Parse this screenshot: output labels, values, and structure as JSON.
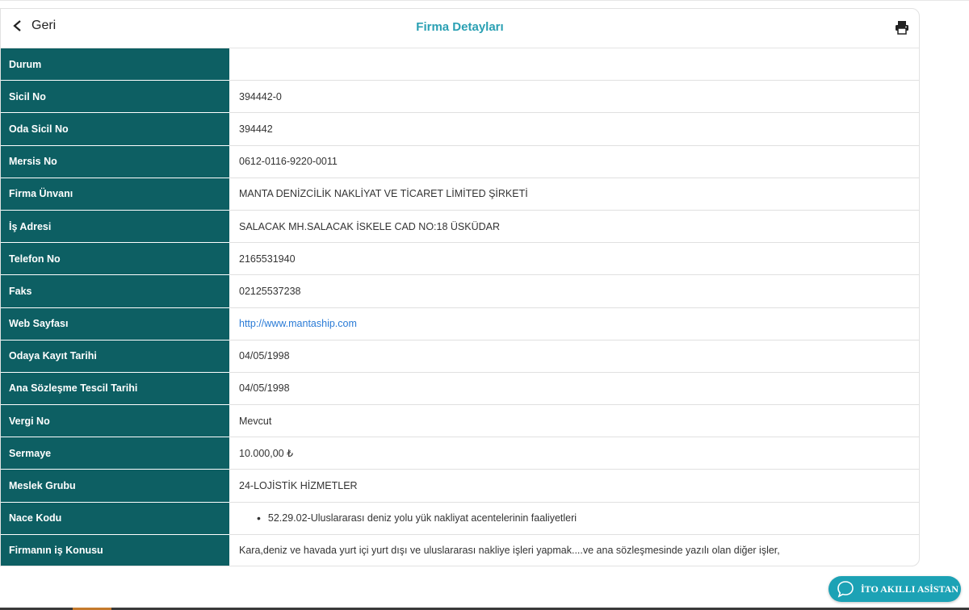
{
  "header": {
    "back_label": "Geri",
    "title": "Firma Detayları"
  },
  "rows": [
    {
      "label": "Durum",
      "value": ""
    },
    {
      "label": "Sicil No",
      "value": "394442-0"
    },
    {
      "label": "Oda Sicil No",
      "value": "394442"
    },
    {
      "label": "Mersis No",
      "value": "0612-0116-9220-0011"
    },
    {
      "label": "Firma Ünvanı",
      "value": "MANTA DENİZCİLİK NAKLİYAT VE TİCARET LİMİTED ŞİRKETİ"
    },
    {
      "label": "İş Adresi",
      "value": "SALACAK MH.SALACAK İSKELE CAD NO:18 ÜSKÜDAR"
    },
    {
      "label": "Telefon No",
      "value": "2165531940"
    },
    {
      "label": "Faks",
      "value": "02125537238"
    },
    {
      "label": "Web Sayfası",
      "value": "http://www.mantaship.com"
    },
    {
      "label": "Odaya Kayıt Tarihi",
      "value": "04/05/1998"
    },
    {
      "label": "Ana Sözleşme Tescil Tarihi",
      "value": "04/05/1998"
    },
    {
      "label": "Vergi No",
      "value": "Mevcut"
    },
    {
      "label": "Sermaye",
      "value": "10.000,00 ₺"
    },
    {
      "label": "Meslek Grubu",
      "value": "24-LOJİSTİK HİZMETLER"
    },
    {
      "label": "Nace Kodu",
      "value": "52.29.02-Uluslararası deniz yolu yük nakliyat acentelerinin faaliyetleri"
    },
    {
      "label": "Firmanın iş Konusu",
      "value": "Kara,deniz ve havada yurt içi yurt dışı ve uluslararası nakliye işleri yapmak....ve ana sözleşmesinde yazılı olan diğer işler,"
    }
  ],
  "assistant": {
    "label": "İTO AKILLI ASİSTAN"
  },
  "colors": {
    "label_bg": "#0d5f63",
    "title": "#2aa0b3",
    "link": "#2a7bd6",
    "assistant_bg": "#1ca2b5"
  },
  "icons": [
    "chevron-left-icon",
    "printer-icon",
    "chat-bubble-icon"
  ]
}
